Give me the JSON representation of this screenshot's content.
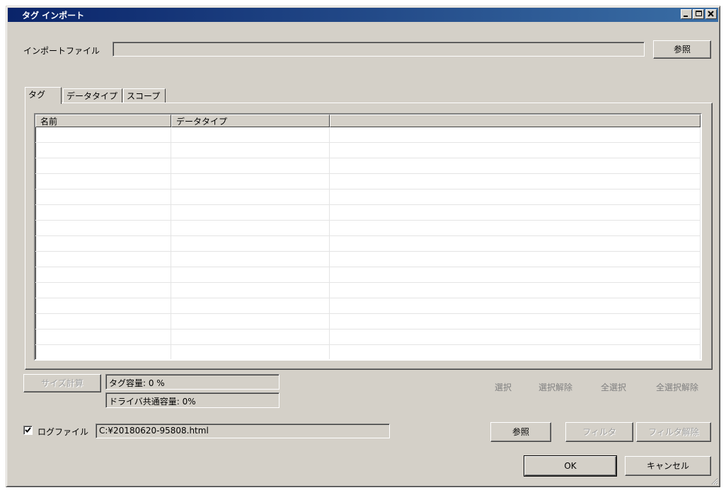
{
  "window": {
    "title": "タグ インポート"
  },
  "import_file": {
    "label": "インポートファイル",
    "value": "",
    "browse_label": "参照"
  },
  "tabs": [
    {
      "label": "タグ",
      "active": true
    },
    {
      "label": "データタイプ",
      "active": false
    },
    {
      "label": "スコープ",
      "active": false
    }
  ],
  "table": {
    "columns": [
      "名前",
      "データタイプ",
      ""
    ],
    "row_count": 15
  },
  "size": {
    "calc_label": "サイズ計算",
    "tag_capacity": "タグ容量: 0 %",
    "driver_capacity": "ドライバ共通容量: 0%"
  },
  "selection_links": {
    "select": "選択",
    "deselect": "選択解除",
    "select_all": "全選択",
    "deselect_all": "全選択解除"
  },
  "logfile": {
    "checked": true,
    "label": "ログファイル",
    "path": "C:¥20180620-95808.html",
    "browse_label": "参照",
    "filter_label": "フィルタ",
    "filter_clear_label": "フィルタ解除"
  },
  "dialog_buttons": {
    "ok": "OK",
    "cancel": "キャンセル"
  }
}
